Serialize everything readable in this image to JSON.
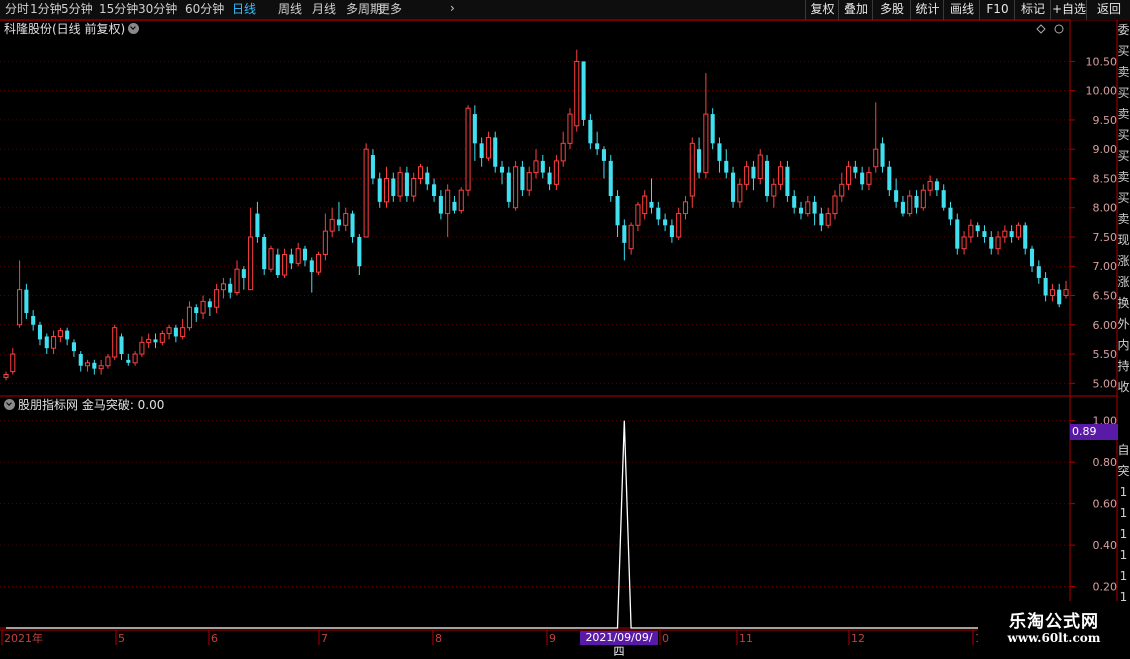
{
  "toolbar": {
    "periods": [
      "分时",
      "1分钟",
      "5分钟",
      "15分钟",
      "30分钟",
      "60分钟",
      "日线",
      "周线",
      "月线",
      "多周期",
      "更多"
    ],
    "active_period": "日线",
    "right_buttons": [
      "复权",
      "叠加",
      "多股",
      "统计",
      "画线",
      "F10",
      "标记",
      "+自选",
      "返回"
    ]
  },
  "main_chart": {
    "title": "科隆股份(日线 前复权)",
    "y_ticks": [
      "10.50",
      "10.00",
      "9.50",
      "9.00",
      "8.50",
      "8.00",
      "7.50",
      "7.00",
      "6.50",
      "6.00",
      "5.50",
      "5.00"
    ]
  },
  "indicator": {
    "title": "股朋指标网 金马突破: 0.00",
    "y_ticks": [
      "1.00",
      "0.80",
      "0.60",
      "0.40",
      "0.20"
    ],
    "last_value": "0.89"
  },
  "x_axis": {
    "labels": [
      "2021年",
      "5",
      "6",
      "7",
      "8",
      "9",
      "0",
      "11",
      "12",
      "1"
    ],
    "cursor_date": "2021/09/09/四"
  },
  "right_strip": [
    "委",
    "买",
    "卖",
    "买",
    "卖",
    "买",
    "买",
    "卖",
    "买",
    "卖",
    "现",
    "涨",
    "涨",
    "换",
    "外",
    "内",
    "持",
    "收",
    "",
    "",
    "自",
    "突",
    "1",
    "1",
    "1",
    "1",
    "1",
    "1",
    "1",
    "1"
  ],
  "watermark": {
    "title": "乐淘公式网",
    "url": "www.60lt.com"
  },
  "colors": {
    "up": "#ff4040",
    "down": "#40e0f0",
    "axis": "#b00000",
    "grid": "#5a0000",
    "line": "#ffffff",
    "badge": "#5a1aa8"
  },
  "chart_data": {
    "type": "candlestick",
    "title": "科隆股份(日线 前复权)",
    "price_range": [
      4.8,
      10.9
    ],
    "candles": [
      {
        "o": 5.1,
        "c": 5.15,
        "h": 5.2,
        "l": 5.05
      },
      {
        "o": 5.2,
        "c": 5.5,
        "h": 5.6,
        "l": 5.15
      },
      {
        "o": 6.0,
        "c": 6.6,
        "h": 7.1,
        "l": 5.95
      },
      {
        "o": 6.6,
        "c": 6.2,
        "h": 6.7,
        "l": 6.1
      },
      {
        "o": 6.15,
        "c": 6.0,
        "h": 6.25,
        "l": 5.9
      },
      {
        "o": 6.0,
        "c": 5.75,
        "h": 6.05,
        "l": 5.65
      },
      {
        "o": 5.8,
        "c": 5.6,
        "h": 5.85,
        "l": 5.5
      },
      {
        "o": 5.6,
        "c": 5.8,
        "h": 5.9,
        "l": 5.5
      },
      {
        "o": 5.8,
        "c": 5.9,
        "h": 5.95,
        "l": 5.7
      },
      {
        "o": 5.9,
        "c": 5.75,
        "h": 5.95,
        "l": 5.65
      },
      {
        "o": 5.7,
        "c": 5.55,
        "h": 5.75,
        "l": 5.45
      },
      {
        "o": 5.5,
        "c": 5.3,
        "h": 5.55,
        "l": 5.2
      },
      {
        "o": 5.3,
        "c": 5.35,
        "h": 5.4,
        "l": 5.2
      },
      {
        "o": 5.35,
        "c": 5.25,
        "h": 5.4,
        "l": 5.15
      },
      {
        "o": 5.25,
        "c": 5.3,
        "h": 5.4,
        "l": 5.15
      },
      {
        "o": 5.3,
        "c": 5.45,
        "h": 5.5,
        "l": 5.25
      },
      {
        "o": 5.45,
        "c": 5.95,
        "h": 6.0,
        "l": 5.4
      },
      {
        "o": 5.8,
        "c": 5.5,
        "h": 5.85,
        "l": 5.4
      },
      {
        "o": 5.4,
        "c": 5.35,
        "h": 5.5,
        "l": 5.3
      },
      {
        "o": 5.35,
        "c": 5.5,
        "h": 5.55,
        "l": 5.3
      },
      {
        "o": 5.5,
        "c": 5.7,
        "h": 5.8,
        "l": 5.45
      },
      {
        "o": 5.7,
        "c": 5.75,
        "h": 5.85,
        "l": 5.6
      },
      {
        "o": 5.75,
        "c": 5.7,
        "h": 5.85,
        "l": 5.6
      },
      {
        "o": 5.7,
        "c": 5.85,
        "h": 5.9,
        "l": 5.65
      },
      {
        "o": 5.85,
        "c": 5.95,
        "h": 6.0,
        "l": 5.75
      },
      {
        "o": 5.95,
        "c": 5.8,
        "h": 6.0,
        "l": 5.7
      },
      {
        "o": 5.8,
        "c": 5.95,
        "h": 6.1,
        "l": 5.75
      },
      {
        "o": 5.95,
        "c": 6.3,
        "h": 6.4,
        "l": 5.9
      },
      {
        "o": 6.3,
        "c": 6.2,
        "h": 6.35,
        "l": 6.05
      },
      {
        "o": 6.2,
        "c": 6.4,
        "h": 6.5,
        "l": 6.1
      },
      {
        "o": 6.4,
        "c": 6.3,
        "h": 6.45,
        "l": 6.15
      },
      {
        "o": 6.3,
        "c": 6.6,
        "h": 6.7,
        "l": 6.2
      },
      {
        "o": 6.6,
        "c": 6.7,
        "h": 6.8,
        "l": 6.45
      },
      {
        "o": 6.7,
        "c": 6.55,
        "h": 6.8,
        "l": 6.45
      },
      {
        "o": 6.55,
        "c": 6.95,
        "h": 7.1,
        "l": 6.5
      },
      {
        "o": 6.95,
        "c": 6.8,
        "h": 7.0,
        "l": 6.6
      },
      {
        "o": 6.6,
        "c": 7.5,
        "h": 8.0,
        "l": 6.6
      },
      {
        "o": 7.9,
        "c": 7.5,
        "h": 8.1,
        "l": 7.4
      },
      {
        "o": 7.5,
        "c": 6.95,
        "h": 7.55,
        "l": 6.85
      },
      {
        "o": 6.95,
        "c": 7.3,
        "h": 7.35,
        "l": 6.9
      },
      {
        "o": 7.2,
        "c": 6.85,
        "h": 7.3,
        "l": 6.8
      },
      {
        "o": 6.85,
        "c": 7.2,
        "h": 7.3,
        "l": 6.8
      },
      {
        "o": 7.2,
        "c": 7.05,
        "h": 7.3,
        "l": 6.95
      },
      {
        "o": 7.05,
        "c": 7.3,
        "h": 7.4,
        "l": 7.0
      },
      {
        "o": 7.3,
        "c": 7.1,
        "h": 7.35,
        "l": 7.0
      },
      {
        "o": 7.1,
        "c": 6.9,
        "h": 7.15,
        "l": 6.55
      },
      {
        "o": 6.9,
        "c": 7.2,
        "h": 7.25,
        "l": 6.85
      },
      {
        "o": 7.2,
        "c": 7.6,
        "h": 7.9,
        "l": 7.1
      },
      {
        "o": 7.6,
        "c": 7.8,
        "h": 8.0,
        "l": 7.5
      },
      {
        "o": 7.8,
        "c": 7.7,
        "h": 8.1,
        "l": 7.6
      },
      {
        "o": 7.7,
        "c": 7.9,
        "h": 8.0,
        "l": 7.6
      },
      {
        "o": 7.9,
        "c": 7.5,
        "h": 7.95,
        "l": 7.4
      },
      {
        "o": 7.5,
        "c": 7.0,
        "h": 7.55,
        "l": 6.85
      },
      {
        "o": 7.5,
        "c": 9.0,
        "h": 9.1,
        "l": 7.5
      },
      {
        "o": 8.9,
        "c": 8.5,
        "h": 9.0,
        "l": 8.4
      },
      {
        "o": 8.5,
        "c": 8.1,
        "h": 8.6,
        "l": 8.0
      },
      {
        "o": 8.1,
        "c": 8.5,
        "h": 8.7,
        "l": 8.0
      },
      {
        "o": 8.5,
        "c": 8.2,
        "h": 8.6,
        "l": 8.1
      },
      {
        "o": 8.2,
        "c": 8.6,
        "h": 8.7,
        "l": 8.1
      },
      {
        "o": 8.6,
        "c": 8.2,
        "h": 8.7,
        "l": 8.1
      },
      {
        "o": 8.2,
        "c": 8.5,
        "h": 8.6,
        "l": 8.1
      },
      {
        "o": 8.5,
        "c": 8.7,
        "h": 8.75,
        "l": 8.4
      },
      {
        "o": 8.6,
        "c": 8.4,
        "h": 8.7,
        "l": 8.3
      },
      {
        "o": 8.4,
        "c": 8.2,
        "h": 8.5,
        "l": 8.1
      },
      {
        "o": 8.2,
        "c": 7.9,
        "h": 8.3,
        "l": 7.8
      },
      {
        "o": 7.9,
        "c": 8.3,
        "h": 8.4,
        "l": 7.5
      },
      {
        "o": 8.1,
        "c": 7.95,
        "h": 8.2,
        "l": 7.9
      },
      {
        "o": 7.95,
        "c": 8.3,
        "h": 8.35,
        "l": 7.9
      },
      {
        "o": 8.3,
        "c": 9.7,
        "h": 9.75,
        "l": 8.2
      },
      {
        "o": 9.6,
        "c": 9.1,
        "h": 9.75,
        "l": 8.8
      },
      {
        "o": 9.1,
        "c": 8.85,
        "h": 9.2,
        "l": 8.7
      },
      {
        "o": 8.85,
        "c": 9.2,
        "h": 9.3,
        "l": 8.8
      },
      {
        "o": 9.2,
        "c": 8.7,
        "h": 9.3,
        "l": 8.6
      },
      {
        "o": 8.7,
        "c": 8.6,
        "h": 8.8,
        "l": 8.4
      },
      {
        "o": 8.6,
        "c": 8.1,
        "h": 8.7,
        "l": 8.0
      },
      {
        "o": 8.0,
        "c": 8.7,
        "h": 8.8,
        "l": 7.95
      },
      {
        "o": 8.7,
        "c": 8.3,
        "h": 8.8,
        "l": 8.2
      },
      {
        "o": 8.3,
        "c": 8.6,
        "h": 8.7,
        "l": 8.2
      },
      {
        "o": 8.6,
        "c": 8.8,
        "h": 9.0,
        "l": 8.5
      },
      {
        "o": 8.8,
        "c": 8.6,
        "h": 8.9,
        "l": 8.5
      },
      {
        "o": 8.6,
        "c": 8.4,
        "h": 8.7,
        "l": 8.3
      },
      {
        "o": 8.4,
        "c": 8.8,
        "h": 8.9,
        "l": 8.3
      },
      {
        "o": 8.8,
        "c": 9.1,
        "h": 9.3,
        "l": 8.7
      },
      {
        "o": 9.1,
        "c": 9.6,
        "h": 9.7,
        "l": 9.0
      },
      {
        "o": 9.4,
        "c": 10.5,
        "h": 10.7,
        "l": 9.3
      },
      {
        "o": 10.5,
        "c": 9.5,
        "h": 10.5,
        "l": 9.4
      },
      {
        "o": 9.5,
        "c": 9.1,
        "h": 9.6,
        "l": 9.0
      },
      {
        "o": 9.1,
        "c": 9.0,
        "h": 9.3,
        "l": 8.9
      },
      {
        "o": 9.0,
        "c": 8.8,
        "h": 9.05,
        "l": 8.5
      },
      {
        "o": 8.8,
        "c": 8.2,
        "h": 8.9,
        "l": 8.1
      },
      {
        "o": 8.2,
        "c": 7.7,
        "h": 8.3,
        "l": 7.5
      },
      {
        "o": 7.7,
        "c": 7.4,
        "h": 7.8,
        "l": 7.1
      },
      {
        "o": 7.3,
        "c": 7.7,
        "h": 7.75,
        "l": 7.2
      },
      {
        "o": 7.7,
        "c": 8.05,
        "h": 8.1,
        "l": 7.6
      },
      {
        "o": 7.9,
        "c": 8.2,
        "h": 8.3,
        "l": 7.8
      },
      {
        "o": 8.1,
        "c": 8.0,
        "h": 8.5,
        "l": 7.9
      },
      {
        "o": 8.0,
        "c": 7.8,
        "h": 8.1,
        "l": 7.7
      },
      {
        "o": 7.8,
        "c": 7.7,
        "h": 7.9,
        "l": 7.6
      },
      {
        "o": 7.7,
        "c": 7.5,
        "h": 7.8,
        "l": 7.4
      },
      {
        "o": 7.5,
        "c": 7.9,
        "h": 8.0,
        "l": 7.45
      },
      {
        "o": 7.9,
        "c": 8.1,
        "h": 8.2,
        "l": 7.8
      },
      {
        "o": 8.2,
        "c": 9.1,
        "h": 9.2,
        "l": 8.0
      },
      {
        "o": 9.0,
        "c": 8.6,
        "h": 9.2,
        "l": 8.5
      },
      {
        "o": 8.6,
        "c": 9.6,
        "h": 10.3,
        "l": 8.5
      },
      {
        "o": 9.6,
        "c": 9.1,
        "h": 9.7,
        "l": 9.0
      },
      {
        "o": 9.1,
        "c": 8.8,
        "h": 9.2,
        "l": 8.6
      },
      {
        "o": 8.8,
        "c": 8.6,
        "h": 9.0,
        "l": 8.5
      },
      {
        "o": 8.6,
        "c": 8.1,
        "h": 8.7,
        "l": 8.0
      },
      {
        "o": 8.1,
        "c": 8.4,
        "h": 8.5,
        "l": 8.0
      },
      {
        "o": 8.4,
        "c": 8.7,
        "h": 8.8,
        "l": 8.3
      },
      {
        "o": 8.7,
        "c": 8.5,
        "h": 8.8,
        "l": 8.3
      },
      {
        "o": 8.5,
        "c": 8.9,
        "h": 9.0,
        "l": 8.4
      },
      {
        "o": 8.8,
        "c": 8.2,
        "h": 8.9,
        "l": 8.1
      },
      {
        "o": 8.2,
        "c": 8.4,
        "h": 8.5,
        "l": 8.0
      },
      {
        "o": 8.4,
        "c": 8.7,
        "h": 8.8,
        "l": 8.3
      },
      {
        "o": 8.7,
        "c": 8.2,
        "h": 8.8,
        "l": 8.1
      },
      {
        "o": 8.2,
        "c": 8.0,
        "h": 8.3,
        "l": 7.9
      },
      {
        "o": 8.0,
        "c": 7.9,
        "h": 8.1,
        "l": 7.8
      },
      {
        "o": 7.9,
        "c": 8.1,
        "h": 8.2,
        "l": 7.85
      },
      {
        "o": 8.1,
        "c": 7.9,
        "h": 8.2,
        "l": 7.7
      },
      {
        "o": 7.9,
        "c": 7.7,
        "h": 8.0,
        "l": 7.6
      },
      {
        "o": 7.7,
        "c": 7.9,
        "h": 8.0,
        "l": 7.65
      },
      {
        "o": 7.9,
        "c": 8.2,
        "h": 8.3,
        "l": 7.8
      },
      {
        "o": 8.2,
        "c": 8.4,
        "h": 8.6,
        "l": 8.1
      },
      {
        "o": 8.4,
        "c": 8.7,
        "h": 8.8,
        "l": 8.3
      },
      {
        "o": 8.7,
        "c": 8.6,
        "h": 8.8,
        "l": 8.5
      },
      {
        "o": 8.6,
        "c": 8.4,
        "h": 8.7,
        "l": 8.3
      },
      {
        "o": 8.4,
        "c": 8.6,
        "h": 8.7,
        "l": 8.3
      },
      {
        "o": 8.7,
        "c": 9.0,
        "h": 9.8,
        "l": 8.6
      },
      {
        "o": 9.1,
        "c": 8.7,
        "h": 9.2,
        "l": 8.6
      },
      {
        "o": 8.7,
        "c": 8.3,
        "h": 8.8,
        "l": 8.2
      },
      {
        "o": 8.3,
        "c": 8.1,
        "h": 8.5,
        "l": 8.0
      },
      {
        "o": 8.1,
        "c": 7.9,
        "h": 8.2,
        "l": 7.85
      },
      {
        "o": 7.9,
        "c": 8.2,
        "h": 8.3,
        "l": 7.85
      },
      {
        "o": 8.2,
        "c": 8.0,
        "h": 8.3,
        "l": 7.9
      },
      {
        "o": 8.0,
        "c": 8.3,
        "h": 8.4,
        "l": 7.95
      },
      {
        "o": 8.3,
        "c": 8.45,
        "h": 8.55,
        "l": 8.2
      },
      {
        "o": 8.45,
        "c": 8.3,
        "h": 8.5,
        "l": 8.2
      },
      {
        "o": 8.3,
        "c": 8.0,
        "h": 8.4,
        "l": 7.95
      },
      {
        "o": 8.0,
        "c": 7.8,
        "h": 8.1,
        "l": 7.7
      },
      {
        "o": 7.8,
        "c": 7.3,
        "h": 7.9,
        "l": 7.2
      },
      {
        "o": 7.3,
        "c": 7.5,
        "h": 7.6,
        "l": 7.2
      },
      {
        "o": 7.5,
        "c": 7.7,
        "h": 7.8,
        "l": 7.4
      },
      {
        "o": 7.7,
        "c": 7.6,
        "h": 7.75,
        "l": 7.5
      },
      {
        "o": 7.6,
        "c": 7.5,
        "h": 7.7,
        "l": 7.4
      },
      {
        "o": 7.5,
        "c": 7.3,
        "h": 7.6,
        "l": 7.2
      },
      {
        "o": 7.3,
        "c": 7.5,
        "h": 7.6,
        "l": 7.2
      },
      {
        "o": 7.5,
        "c": 7.6,
        "h": 7.7,
        "l": 7.4
      },
      {
        "o": 7.6,
        "c": 7.5,
        "h": 7.7,
        "l": 7.4
      },
      {
        "o": 7.5,
        "c": 7.7,
        "h": 7.75,
        "l": 7.45
      },
      {
        "o": 7.7,
        "c": 7.3,
        "h": 7.75,
        "l": 7.2
      },
      {
        "o": 7.3,
        "c": 7.0,
        "h": 7.35,
        "l": 6.9
      },
      {
        "o": 7.0,
        "c": 6.8,
        "h": 7.1,
        "l": 6.7
      },
      {
        "o": 6.8,
        "c": 6.5,
        "h": 6.9,
        "l": 6.4
      },
      {
        "o": 6.5,
        "c": 6.6,
        "h": 6.7,
        "l": 6.4
      },
      {
        "o": 6.6,
        "c": 6.35,
        "h": 6.7,
        "l": 6.3
      },
      {
        "o": 6.5,
        "c": 6.6,
        "h": 6.75,
        "l": 6.45
      }
    ],
    "indicator": {
      "name": "金马突破",
      "value_range": [
        0,
        1.1
      ],
      "series": [
        {
          "values": [
            0,
            0,
            0,
            0,
            0,
            0,
            0,
            0,
            0,
            0,
            0,
            0,
            0,
            0,
            0,
            0,
            0,
            0,
            0,
            0,
            0,
            0,
            0,
            0,
            0,
            0,
            0,
            0,
            0,
            0,
            0,
            0,
            0,
            0,
            0,
            0,
            0,
            0,
            0,
            0,
            0,
            0,
            0,
            0,
            0,
            0,
            0,
            0,
            0,
            0,
            0,
            0,
            0,
            0,
            0,
            0,
            0,
            0,
            0,
            0,
            0,
            0,
            0,
            0,
            0,
            0,
            0,
            0,
            0,
            0,
            0,
            0,
            0,
            0,
            0,
            0,
            0,
            0,
            0,
            0,
            0,
            0,
            0,
            0,
            0,
            0,
            0,
            0,
            0,
            0,
            0,
            1,
            0,
            0,
            0,
            0,
            0,
            0,
            0,
            0,
            0,
            0,
            0,
            0,
            0,
            0,
            0,
            0,
            0,
            0,
            0,
            0,
            0,
            0,
            0,
            0,
            0,
            0,
            0,
            0,
            0,
            0,
            0,
            0,
            0,
            0,
            0,
            0,
            0,
            0,
            0,
            0,
            0,
            0,
            0,
            0,
            0,
            0,
            0,
            0,
            0,
            0,
            0,
            0,
            0,
            0,
            0,
            0,
            0,
            0,
            0,
            0,
            0,
            0,
            0,
            0,
            0,
            0,
            0,
            0,
            0,
            0
          ]
        }
      ]
    }
  }
}
